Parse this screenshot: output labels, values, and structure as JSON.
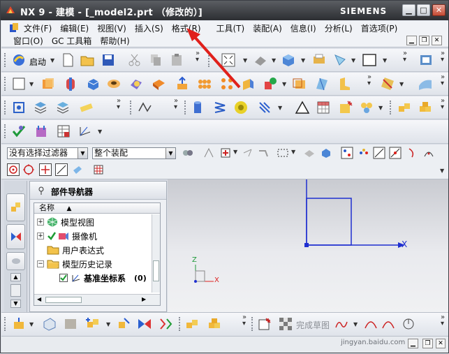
{
  "window": {
    "title": "NX 9 - 建模 - [_model2.prt （修改的）]",
    "brand": "SIEMENS",
    "controls": [
      "▁",
      "□",
      "✕"
    ]
  },
  "menu": {
    "row1": [
      "文件(F)",
      "编辑(E)",
      "视图(V)",
      "插入(S)",
      "格式(R)",
      "工具(T)",
      "装配(A)",
      "信息(I)",
      "分析(L)",
      "首选项(P)"
    ],
    "row2": [
      "窗口(O)",
      "GC 工具箱",
      "帮助(H)"
    ],
    "start_label": "启动"
  },
  "filter": {
    "selection_filter": "没有选择过滤器",
    "scope": "整个装配"
  },
  "navigator": {
    "title": "部件导航器",
    "column_header": "名称",
    "nodes": [
      {
        "label": "模型视图",
        "expander": "+"
      },
      {
        "label": "摄像机",
        "expander": "+"
      },
      {
        "label": "用户表达式",
        "expander": ""
      },
      {
        "label": "模型历史记录",
        "expander": "−"
      },
      {
        "label": "基准坐标系",
        "suffix": "(0)"
      }
    ]
  },
  "viewport": {
    "axis_x": "X",
    "triad_x": "X",
    "triad_z": "Z"
  },
  "bottom_toolbar": {
    "finish_sketch": "完成草图"
  },
  "watermark": "jingyan.baidu.com",
  "colors": {
    "accent_blue": "#1f2fd0",
    "arrow_red": "#e0201b"
  }
}
